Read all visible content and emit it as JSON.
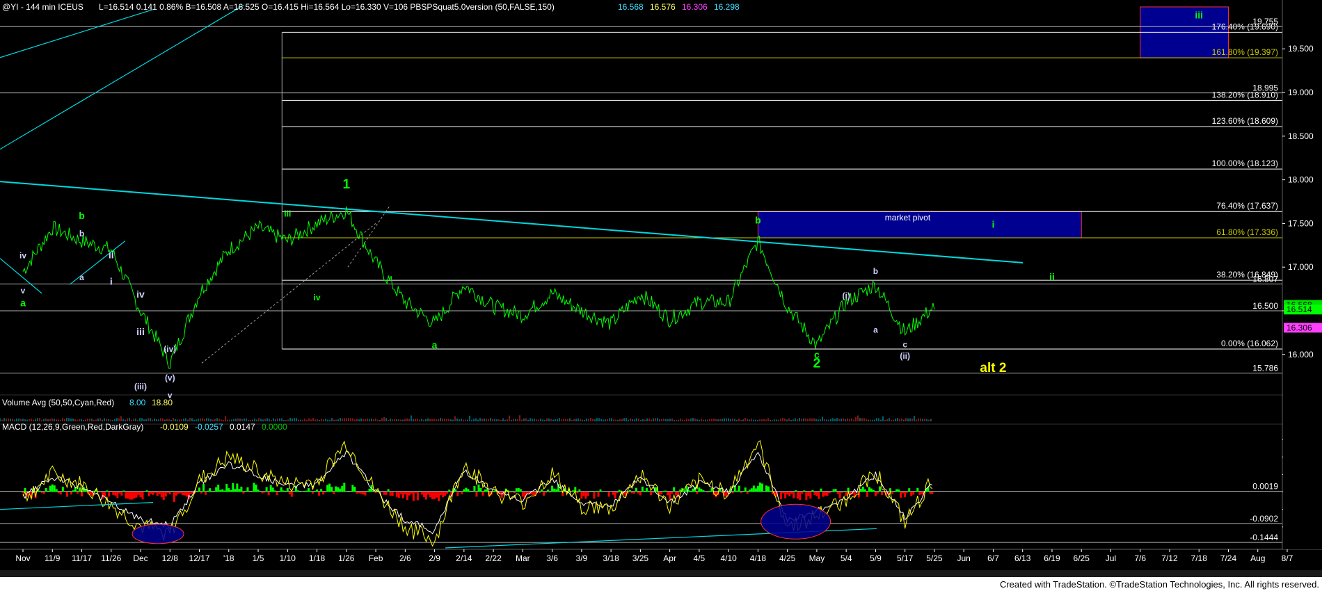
{
  "header": {
    "symbol": "@YI - 144 min  ICEUS",
    "stats": "L=16.514  0.141  0.86%  B=16.508  A=16.525  O=16.415  Hi=16.564  Lo=16.330  V=106  PBSPSquat5.0version (50,FALSE,150)",
    "levels": [
      {
        "text": "16.568",
        "color": "#40e0ff"
      },
      {
        "text": "16.576",
        "color": "#ffff60"
      },
      {
        "text": "16.306",
        "color": "#ff40ff"
      },
      {
        "text": "16.298",
        "color": "#40e0ff"
      }
    ]
  },
  "volume_header": {
    "label": "Volume Avg (50,50,Cyan,Red)",
    "v1": "8.00",
    "v2": "18.80"
  },
  "macd_header": {
    "label": "MACD (12,26,9,Green,Red,DarkGray)",
    "v1": "-0.0109",
    "v2": "-0.0257",
    "v3": "0.0147",
    "v4": "0.0000"
  },
  "footer": {
    "credit": "Created with TradeStation. ©TradeStation Technologies, Inc. All rights reserved."
  },
  "colors": {
    "price": "#00ff00",
    "trend": "#00d8e0",
    "fib": "#ffffff",
    "fib_gold": "#c8c800",
    "pivot_box": "#000090",
    "macd_fast": "#ffff00",
    "macd_slow": "#ffffff",
    "hist_up": "#00ff00",
    "hist_dn": "#ff0000"
  },
  "chart_data": [
    {
      "type": "line",
      "title": "@YI - 144 min  ICEUS",
      "ylim": [
        15.6,
        19.9
      ],
      "y_ticks": [
        "19.500",
        "19.000",
        "18.500",
        "18.000",
        "17.500",
        "17.000",
        "16.500",
        "16.000"
      ],
      "x_ticks": [
        "Nov",
        "11/9",
        "11/17",
        "11/26",
        "Dec",
        "12/8",
        "12/17",
        "'18",
        "1/5",
        "1/10",
        "1/18",
        "1/26",
        "Feb",
        "2/6",
        "2/9",
        "2/14",
        "2/22",
        "Mar",
        "3/6",
        "3/9",
        "3/18",
        "3/25",
        "Apr",
        "4/5",
        "4/10",
        "4/18",
        "4/25",
        "May",
        "5/4",
        "5/9",
        "5/17",
        "5/25",
        "Jun",
        "6/7",
        "6/13",
        "6/19",
        "6/25",
        "Jul",
        "7/6",
        "7/12",
        "7/18",
        "7/24",
        "Aug",
        "8/7"
      ],
      "price_path": [
        {
          "x": "Nov",
          "y": 16.95
        },
        {
          "x": "11/9",
          "y": 17.45
        },
        {
          "x": "11/17",
          "y": 17.3
        },
        {
          "x": "11/26",
          "y": 17.2
        },
        {
          "x": "Dec",
          "y": 16.5
        },
        {
          "x": "12/8",
          "y": 15.9
        },
        {
          "x": "12/17",
          "y": 16.7
        },
        {
          "x": "'18",
          "y": 17.2
        },
        {
          "x": "1/5",
          "y": 17.45
        },
        {
          "x": "1/10",
          "y": 17.3
        },
        {
          "x": "1/18",
          "y": 17.5
        },
        {
          "x": "1/26",
          "y": 17.65
        },
        {
          "x": "Feb",
          "y": 17.05
        },
        {
          "x": "2/6",
          "y": 16.6
        },
        {
          "x": "2/9",
          "y": 16.35
        },
        {
          "x": "2/14",
          "y": 16.8
        },
        {
          "x": "2/22",
          "y": 16.55
        },
        {
          "x": "Mar",
          "y": 16.45
        },
        {
          "x": "3/6",
          "y": 16.7
        },
        {
          "x": "3/9",
          "y": 16.5
        },
        {
          "x": "3/18",
          "y": 16.35
        },
        {
          "x": "3/25",
          "y": 16.7
        },
        {
          "x": "Apr",
          "y": 16.4
        },
        {
          "x": "4/5",
          "y": 16.6
        },
        {
          "x": "4/10",
          "y": 16.6
        },
        {
          "x": "4/18",
          "y": 17.3
        },
        {
          "x": "4/25",
          "y": 16.55
        },
        {
          "x": "May",
          "y": 16.1
        },
        {
          "x": "5/4",
          "y": 16.6
        },
        {
          "x": "5/9",
          "y": 16.8
        },
        {
          "x": "5/17",
          "y": 16.25
        },
        {
          "x": "5/25",
          "y": 16.55
        }
      ],
      "current_price": 16.514,
      "fib_levels": [
        {
          "label": "176.40% (19.690)",
          "value": 19.69
        },
        {
          "label": "161.80% (19.397)",
          "value": 19.397
        },
        {
          "label": "138.20% (18.910)",
          "value": 18.91
        },
        {
          "label": "123.60% (18.609)",
          "value": 18.609
        },
        {
          "label": "100.00% (18.123)",
          "value": 18.123
        },
        {
          "label": "76.40% (17.637)",
          "value": 17.637
        },
        {
          "label": "61.80% (17.336)",
          "value": 17.336
        },
        {
          "label": "38.20% (16.849)",
          "value": 16.849
        },
        {
          "label": "0.00% (16.062)",
          "value": 16.062
        }
      ],
      "level_labels": [
        {
          "text": "19.755",
          "value": 19.755
        },
        {
          "text": "18.995",
          "value": 18.995
        },
        {
          "text": "16.807",
          "value": 16.807
        },
        {
          "text": "16.500",
          "value": 16.5
        },
        {
          "text": "15.786",
          "value": 15.786
        }
      ],
      "tags": [
        {
          "text": "16.568",
          "value": 16.568,
          "color": "#00e000"
        },
        {
          "text": "16.514",
          "value": 16.514,
          "color": "#00ff00"
        },
        {
          "text": "16.306",
          "value": 16.306,
          "color": "#ff40ff"
        }
      ],
      "zones": [
        {
          "label": "market pivot",
          "from": "4/18",
          "to": "6/25",
          "y_low": 17.336,
          "y_high": 17.637
        },
        {
          "label": "iii",
          "from": "7/6",
          "to": "7/24",
          "y_low": 19.397,
          "y_high": 19.98
        }
      ],
      "wave_labels": [
        {
          "text": "1",
          "x": "1/26",
          "y": 17.9,
          "color": "#00ff00",
          "size": "large"
        },
        {
          "text": "2",
          "x": "May",
          "y": 15.85,
          "color": "#00ff00",
          "size": "large"
        },
        {
          "text": "b",
          "x": "4/18",
          "y": 17.5,
          "color": "#00ff00",
          "size": "medium"
        },
        {
          "text": "b",
          "x": "11/17",
          "y": 17.55,
          "color": "#00ff00",
          "size": "medium"
        },
        {
          "text": "a",
          "x": "Nov",
          "y": 16.55,
          "color": "#00ff00",
          "size": "medium"
        },
        {
          "text": "a",
          "x": "2/9",
          "y": 16.07,
          "color": "#00ff00",
          "size": "medium"
        },
        {
          "text": "c",
          "x": "May",
          "y": 15.96,
          "color": "#00ff00",
          "size": "medium"
        },
        {
          "text": "i",
          "x": "6/7",
          "y": 17.45,
          "color": "#00ff00",
          "size": "medium"
        },
        {
          "text": "ii",
          "x": "6/19",
          "y": 16.85,
          "color": "#00ff00",
          "size": "medium"
        },
        {
          "text": "iii",
          "x": "7/18",
          "y": 19.85,
          "color": "#00ff00",
          "size": "medium"
        },
        {
          "text": "alt 2",
          "x": "6/7",
          "y": 15.8,
          "color": "#ffff00",
          "size": "large"
        },
        {
          "text": "iii",
          "x": "1/10",
          "y": 17.58,
          "color": "#00ff00",
          "size": "small"
        },
        {
          "text": "iv",
          "x": "1/18",
          "y": 16.62,
          "color": "#00ff00",
          "size": "small"
        },
        {
          "text": "iv",
          "x": "Nov",
          "y": 17.1,
          "color": "#d0d0ff",
          "size": "small"
        },
        {
          "text": "v",
          "x": "Nov",
          "y": 16.7,
          "color": "#d0d0ff",
          "size": "small"
        },
        {
          "text": "b",
          "x": "11/17",
          "y": 17.35,
          "color": "#d0d0ff",
          "size": "small"
        },
        {
          "text": "a",
          "x": "11/17",
          "y": 16.85,
          "color": "#d0d0ff",
          "size": "small"
        },
        {
          "text": "ii",
          "x": "11/26",
          "y": 17.1,
          "color": "#d0d0ff",
          "size": "medium"
        },
        {
          "text": "i",
          "x": "11/26",
          "y": 16.8,
          "color": "#d0d0ff",
          "size": "medium"
        },
        {
          "text": "iv",
          "x": "Dec",
          "y": 16.65,
          "color": "#d0d0ff",
          "size": "medium"
        },
        {
          "text": "iii",
          "x": "Dec",
          "y": 16.22,
          "color": "#d0d0ff",
          "size": "medium"
        },
        {
          "text": "(iv)",
          "x": "12/8",
          "y": 16.03,
          "color": "#d0d0ff",
          "size": "small"
        },
        {
          "text": "(iii)",
          "x": "Dec",
          "y": 15.6,
          "color": "#d0d0ff",
          "size": "small"
        },
        {
          "text": "(v)",
          "x": "12/8",
          "y": 15.7,
          "color": "#d0d0ff",
          "size": "small"
        },
        {
          "text": "v",
          "x": "12/8",
          "y": 15.5,
          "color": "#d0d0ff",
          "size": "small"
        },
        {
          "text": "(i)",
          "x": "5/4",
          "y": 16.64,
          "color": "#d0d0ff",
          "size": "small"
        },
        {
          "text": "a",
          "x": "5/9",
          "y": 16.25,
          "color": "#d0d0ff",
          "size": "small"
        },
        {
          "text": "b",
          "x": "5/9",
          "y": 16.92,
          "color": "#d0d0ff",
          "size": "small"
        },
        {
          "text": "c",
          "x": "5/17",
          "y": 16.08,
          "color": "#d0d0ff",
          "size": "small"
        },
        {
          "text": "(ii)",
          "x": "5/17",
          "y": 15.95,
          "color": "#d0d0ff",
          "size": "small"
        }
      ]
    },
    {
      "type": "bar",
      "title": "Volume Avg (50,50,Cyan,Red)",
      "values_note_value": "8"
    },
    {
      "type": "line",
      "title": "MACD (12,26,9,Green,Red,DarkGray)",
      "ylim": [
        -0.16,
        0.17
      ],
      "y_ticks": [
        "0.1500",
        "0.1000",
        "0.0500",
        "0.0000",
        "-0.0500",
        "-0.1000"
      ],
      "level_labels": [
        {
          "text": "0.0019",
          "value": 0.0019
        },
        {
          "text": "-0.0902",
          "value": -0.0902
        },
        {
          "text": "-0.1444",
          "value": -0.1444
        }
      ],
      "tags": [
        {
          "text": "0.0147",
          "value": 0.0147,
          "color": "#00ff00"
        }
      ],
      "macd_path": [
        {
          "x": "Nov",
          "y": -0.02
        },
        {
          "x": "11/9",
          "y": 0.05
        },
        {
          "x": "11/17",
          "y": 0.02
        },
        {
          "x": "11/26",
          "y": -0.04
        },
        {
          "x": "Dec",
          "y": -0.1
        },
        {
          "x": "12/8",
          "y": -0.12
        },
        {
          "x": "12/17",
          "y": 0.03
        },
        {
          "x": "'18",
          "y": 0.1
        },
        {
          "x": "1/5",
          "y": 0.06
        },
        {
          "x": "1/10",
          "y": 0.02
        },
        {
          "x": "1/18",
          "y": 0.03
        },
        {
          "x": "1/26",
          "y": 0.14
        },
        {
          "x": "Feb",
          "y": 0.0
        },
        {
          "x": "2/6",
          "y": -0.1
        },
        {
          "x": "2/9",
          "y": -0.14
        },
        {
          "x": "2/14",
          "y": 0.08
        },
        {
          "x": "2/22",
          "y": 0.0
        },
        {
          "x": "Mar",
          "y": -0.03
        },
        {
          "x": "3/6",
          "y": 0.05
        },
        {
          "x": "3/9",
          "y": -0.04
        },
        {
          "x": "3/18",
          "y": -0.05
        },
        {
          "x": "3/25",
          "y": 0.05
        },
        {
          "x": "Apr",
          "y": -0.04
        },
        {
          "x": "4/5",
          "y": 0.03
        },
        {
          "x": "4/10",
          "y": 0.0
        },
        {
          "x": "4/18",
          "y": 0.14
        },
        {
          "x": "4/25",
          "y": -0.1
        },
        {
          "x": "May",
          "y": -0.07
        },
        {
          "x": "5/4",
          "y": -0.02
        },
        {
          "x": "5/9",
          "y": 0.06
        },
        {
          "x": "5/17",
          "y": -0.09
        },
        {
          "x": "5/25",
          "y": 0.04
        }
      ]
    }
  ]
}
